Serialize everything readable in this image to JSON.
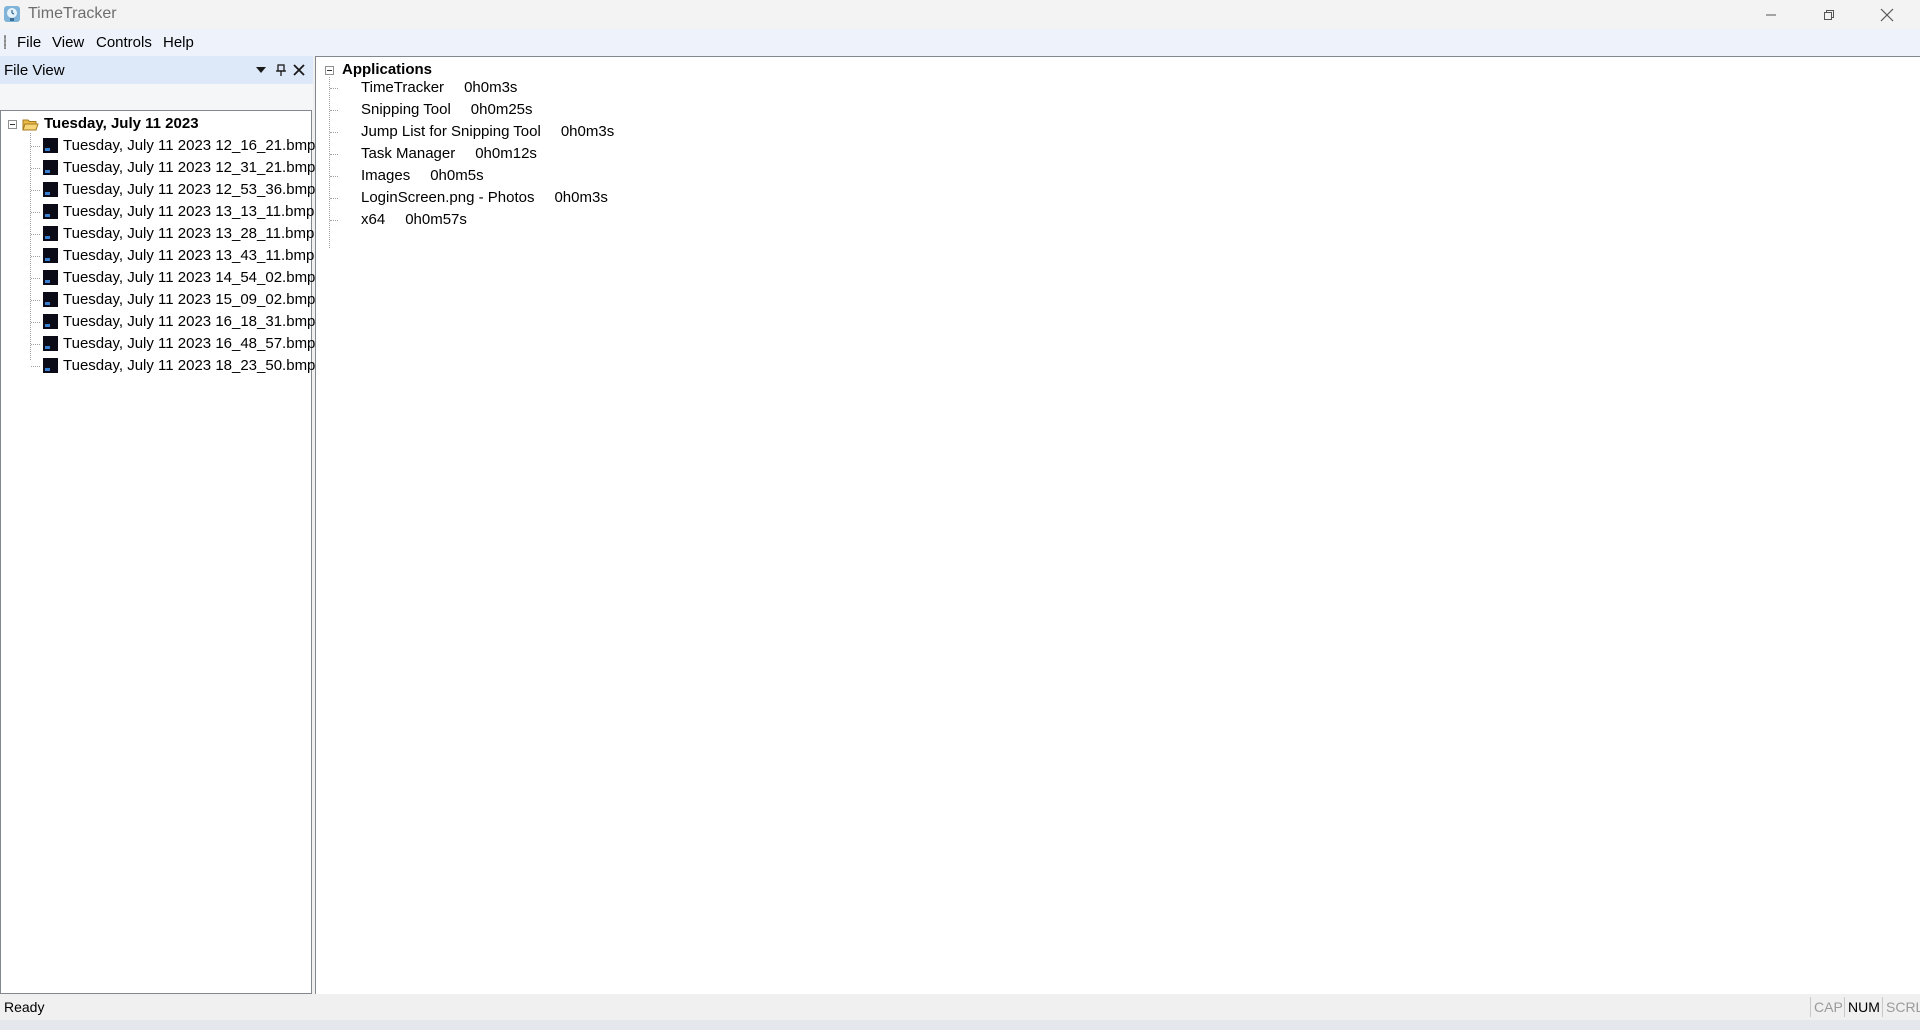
{
  "window": {
    "title": "TimeTracker",
    "icon": "timetracker-app-icon"
  },
  "menu": {
    "items": [
      "File",
      "View",
      "Controls",
      "Help"
    ]
  },
  "file_view": {
    "caption": "File View",
    "root_label": "Tuesday, July 11 2023",
    "files": [
      "Tuesday, July 11 2023 12_16_21.bmp",
      "Tuesday, July 11 2023 12_31_21.bmp",
      "Tuesday, July 11 2023 12_53_36.bmp",
      "Tuesday, July 11 2023 13_13_11.bmp",
      "Tuesday, July 11 2023 13_28_11.bmp",
      "Tuesday, July 11 2023 13_43_11.bmp",
      "Tuesday, July 11 2023 14_54_02.bmp",
      "Tuesday, July 11 2023 15_09_02.bmp",
      "Tuesday, July 11 2023 16_18_31.bmp",
      "Tuesday, July 11 2023 16_48_57.bmp",
      "Tuesday, July 11 2023 18_23_50.bmp"
    ]
  },
  "applications": {
    "root_label": "Applications",
    "items": [
      {
        "name": "TimeTracker",
        "time": "0h0m3s"
      },
      {
        "name": "Snipping Tool",
        "time": "0h0m25s"
      },
      {
        "name": "Jump List for Snipping Tool",
        "time": "0h0m3s"
      },
      {
        "name": "Task Manager",
        "time": "0h0m12s"
      },
      {
        "name": "Images",
        "time": "0h0m5s"
      },
      {
        "name": "LoginScreen.png - Photos",
        "time": "0h0m3s"
      },
      {
        "name": "x64",
        "time": "0h0m57s"
      }
    ]
  },
  "status": {
    "text": "Ready",
    "indicators": {
      "cap": "CAP",
      "num": "NUM",
      "scrl": "SCRL"
    }
  },
  "colors": {
    "menubar": "#eef2fb",
    "pane_caption": "#dde8f8",
    "bmp_icon": "#0b0b18"
  }
}
